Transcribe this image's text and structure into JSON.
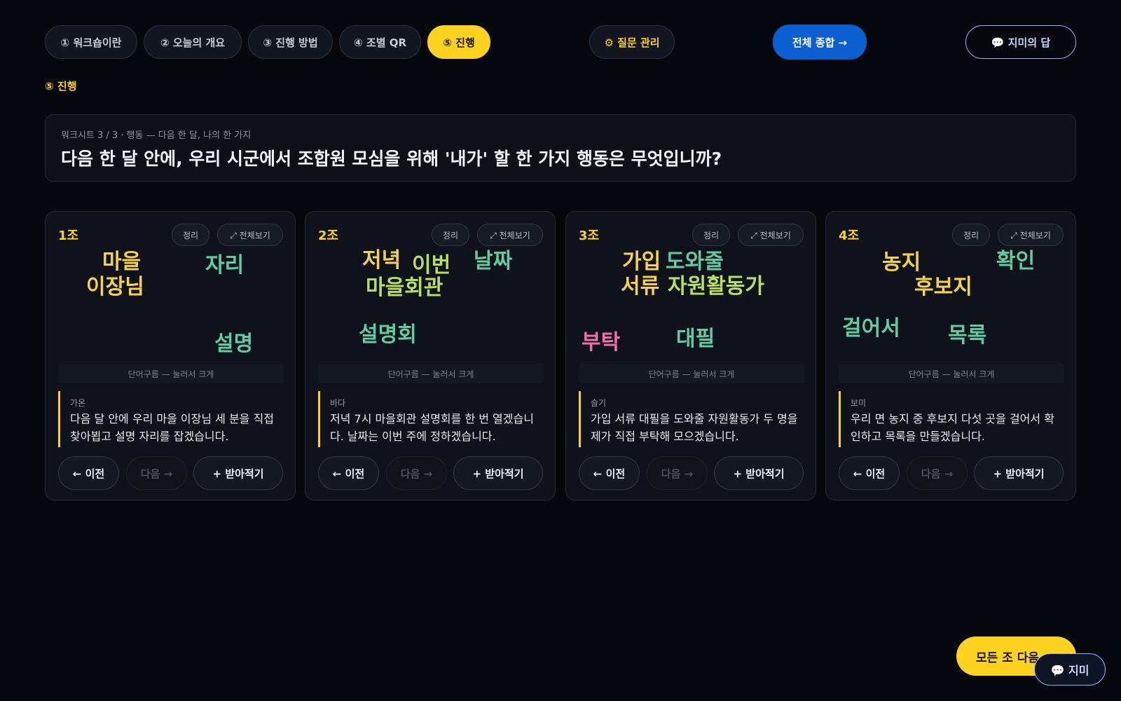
{
  "nav": {
    "tabs": [
      {
        "label": "① 워크숍이란"
      },
      {
        "label": "② 오늘의 개요"
      },
      {
        "label": "③ 진행 방법"
      },
      {
        "label": "④ 조별 QR"
      },
      {
        "label": "⑤ 진행",
        "active": true
      }
    ],
    "manage_label": "⚙ 질문 관리",
    "summary_label": "전체 종합 →",
    "jimi_answer_label": "💬 지미의 답"
  },
  "section_label": "⑤ 진행",
  "question": {
    "subtitle": "워크시트 3 / 3 · 행동 — 다음 한 달, 나의 한 가지",
    "text": "다음 한 달 안에, 우리 시군에서 조합원 모심을 위해 '내가' 할 한 가지 행동은 무엇입니까?"
  },
  "card_labels": {
    "organize": "정리",
    "fullscreen": "⤢ 전체보기",
    "cloud_caption": "단어구름 — 눌러서 크게",
    "prev": "← 이전",
    "next": "다음 →",
    "add": "+ 받아적기"
  },
  "word_colors": {
    "yellow": "#f5d24a",
    "green": "#5fcca3",
    "lime": "#b8df5e",
    "pink": "#f06fa6"
  },
  "groups": [
    {
      "title": "1조",
      "words": [
        "마을",
        "이장님",
        "자리",
        "설명"
      ],
      "answer_name": "가온",
      "answer_text": "다음 달 안에 우리 마을 이장님 세 분을 직접 찾아뵙고 설명 자리를 잡겠습니다."
    },
    {
      "title": "2조",
      "words": [
        "저녁",
        "이번",
        "날짜",
        "마을회관",
        "설명회"
      ],
      "answer_name": "바다",
      "answer_text": "저녁 7시 마을회관 설명회를 한 번 열겠습니다. 날짜는 이번 주에 정하겠습니다."
    },
    {
      "title": "3조",
      "words": [
        "가입",
        "도와줄",
        "서류",
        "자원활동가",
        "부탁",
        "대필"
      ],
      "answer_name": "슬기",
      "answer_text": "가입 서류 대필을 도와줄 자원활동가 두 명을 제가 직접 부탁해 모으겠습니다."
    },
    {
      "title": "4조",
      "words": [
        "농지",
        "확인",
        "후보지",
        "걸어서",
        "목록"
      ],
      "answer_name": "보미",
      "answer_text": "우리 면 농지 중 후보지 다섯 곳을 걸어서 확인하고 목록을 만들겠습니다."
    }
  ],
  "footer": {
    "next_all_label": "모든 조 다음",
    "jimi_label": "💬 지미"
  }
}
